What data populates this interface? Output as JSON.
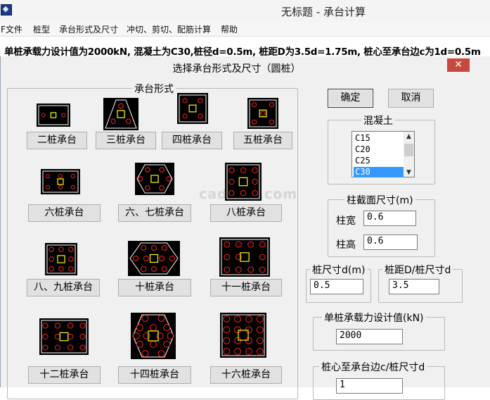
{
  "app": {
    "title": "无标题 - 承台计算"
  },
  "menu": [
    "F文件",
    "桩型",
    "承台形式及尺寸",
    "冲切、剪切、配筋计算",
    "帮助"
  ],
  "info_line": "单桩承载力设计值为2000kN, 混凝土为C30,桩径d=0.5m, 桩距D为3.5d=1.75m, 桩心至承台边c为1d=0.5m",
  "dialog": {
    "title": "选择承台形式及尺寸（圆桩）",
    "close": "✕",
    "group_cap_label": "承台形式",
    "cap_buttons": [
      "二桩承台",
      "三桩承台",
      "四桩承台",
      "五桩承台",
      "六桩承台",
      "六、七桩承台",
      "八桩承台",
      "八、九桩承台",
      "十桩承台",
      "十一桩承台",
      "十二桩承台",
      "十四桩承台",
      "十六桩承台"
    ],
    "ok": "确定",
    "cancel": "取消",
    "concrete": {
      "label": "混凝土",
      "options": [
        "C15",
        "C20",
        "C25",
        "C30"
      ],
      "selected": "C30"
    },
    "column": {
      "label": "柱截面尺寸(m)",
      "width_label": "柱宽",
      "width_value": "0.6",
      "height_label": "柱高",
      "height_value": "0.6"
    },
    "pile_size": {
      "label": "桩尺寸d(m)",
      "value": "0.5"
    },
    "pile_spacing": {
      "label": "桩距D/桩尺寸d",
      "value": "3.5"
    },
    "capacity": {
      "label": "单桩承载力设计值(kN)",
      "value": "2000"
    },
    "edge": {
      "label": "桩心至承台边c/桩尺寸d",
      "value": "1"
    }
  },
  "colors": {
    "selection": "#3399ff",
    "close_button": "#c7483e",
    "pile": "#ff2020",
    "column": "#ffff00"
  },
  "watermark": "cad.ctk.com"
}
